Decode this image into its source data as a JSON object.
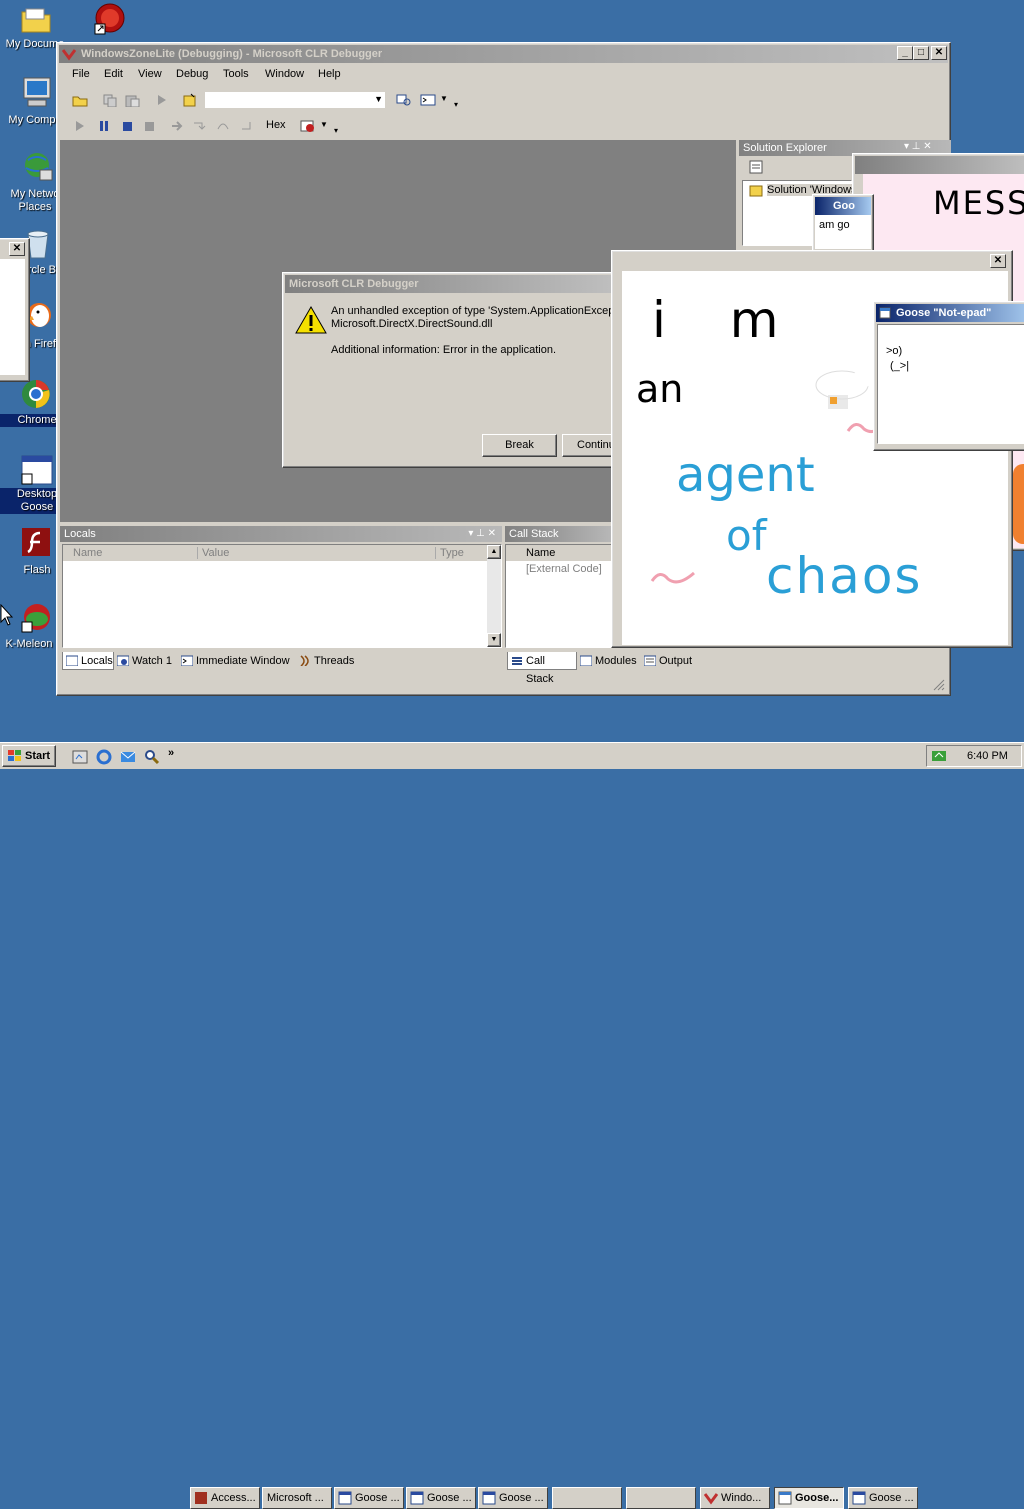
{
  "desktop": {
    "icons": [
      {
        "label": "My Documents",
        "display": "My Docume"
      },
      {
        "label": "My Computer",
        "display": "My Compu"
      },
      {
        "label": "My Network Places",
        "display": "My Netwo\nPlaces"
      },
      {
        "label": "Recycle Bin",
        "display": "rcle B"
      },
      {
        "label": "Firefox",
        "display": "n Firef"
      },
      {
        "label": "Chrome",
        "display": "Chrome"
      },
      {
        "label": "Desktop Goose",
        "display": "Desktop\nGoose"
      },
      {
        "label": "Flash",
        "display": "Flash"
      },
      {
        "label": "K-Meleon",
        "display": "K-Meleon"
      }
    ]
  },
  "debugger": {
    "title": "WindowsZoneLite (Debugging) - Microsoft CLR Debugger",
    "menu": [
      "File",
      "Edit",
      "View",
      "Debug",
      "Tools",
      "Window",
      "Help"
    ],
    "hex_label": "Hex",
    "solution_explorer": {
      "title": "Solution Explorer",
      "item": "Solution 'Windows"
    },
    "locals": {
      "title": "Locals",
      "columns": [
        "Name",
        "Value",
        "Type"
      ]
    },
    "call_stack": {
      "title": "Call Stack",
      "column": "Name",
      "row": "[External Code]"
    },
    "bottom_tabs_left": [
      "Locals",
      "Watch 1",
      "Immediate Window",
      "Threads"
    ],
    "bottom_tabs_right": [
      "Call Stack",
      "Modules",
      "Output"
    ]
  },
  "dialog": {
    "title": "Microsoft CLR Debugger",
    "line1": "An unhandled exception of type 'System.ApplicationExcep",
    "line2": "Microsoft.DirectX.DirectSound.dll",
    "line3": "Additional information: Error in the application.",
    "break_label": "Break",
    "continue_label": "Continu"
  },
  "small_window": {
    "title": "Goo",
    "text": "am go"
  },
  "notepad": {
    "title": "Goose \"Not-epad\"",
    "line1": ">o)",
    "line2": "(_>|"
  },
  "mess_window": {
    "text": "MESS WI"
  },
  "drawing": {
    "lines": [
      "i m",
      "an",
      "agent",
      "of",
      "chaos"
    ]
  },
  "taskbar": {
    "start": "Start",
    "quick_more": "»",
    "tasks": [
      "Access...",
      "Microsoft ...",
      "Goose ...",
      "Goose ...",
      "Goose ...",
      "",
      "",
      "Windo...",
      "Goose...",
      "Goose ..."
    ],
    "clock": "6:40 PM"
  },
  "colors": {
    "desktop": "#3a6ea5",
    "title_active": "#0a246a",
    "drawing_ink_black": "#000000",
    "drawing_ink_blue": "#2a9fd6",
    "drawing_ink_pink": "#f0a0b0"
  }
}
